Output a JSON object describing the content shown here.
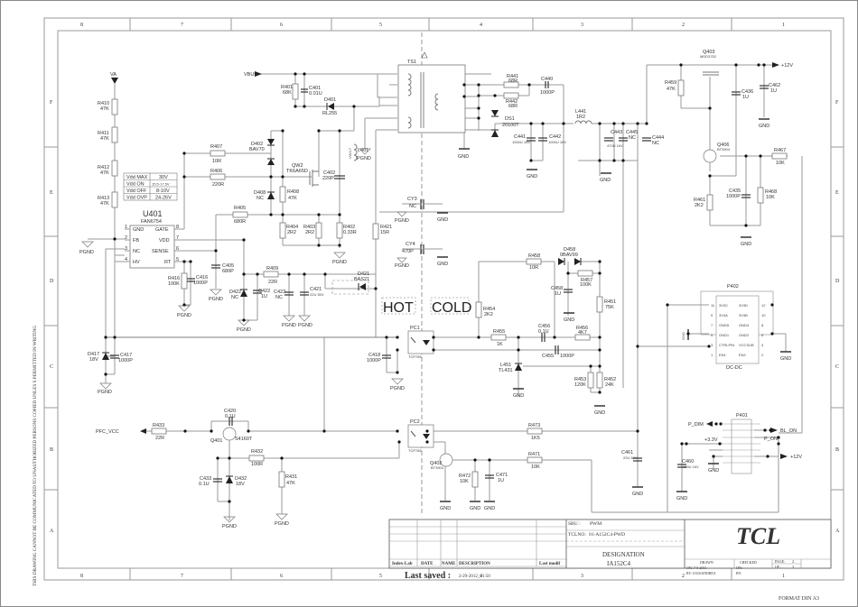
{
  "frame": {
    "columns_top": [
      "8",
      "7",
      "6",
      "5",
      "4",
      "3",
      "2",
      "1"
    ],
    "rows_right": [
      "F",
      "E",
      "D",
      "C",
      "B",
      "A"
    ],
    "rows_left": [
      "F",
      "E",
      "D",
      "C",
      "B",
      "A"
    ],
    "columns_bottom": [
      "8",
      "7",
      "6",
      "5",
      "4",
      "3",
      "2",
      "1"
    ],
    "side_notice": "THIS DRAWING CANNOT BE COMMUNICATED TO UNAUTHORIZED PERSONS COPIED UNLES S PERMITTED IN WRITING",
    "format": "FORMAT DIN A3"
  },
  "nets": {
    "va": "VA",
    "vbus": "VBUS",
    "pfc_vcc": "PFC_VCC",
    "p12v_top": "+12V",
    "p12v_bottom": "+12V",
    "p_dim": "P_DIM",
    "bl_on": "BL_ON",
    "p_on": "P_ON",
    "p3v3": "+3.3V",
    "hot": "HOT",
    "cold": "COLD"
  },
  "grounds": {
    "pgnd": "PGND",
    "gnd": "GND"
  },
  "u401": {
    "ref": "U401",
    "part": "FAN6754",
    "pins_left": [
      {
        "num": "1",
        "name": "GND"
      },
      {
        "num": "2",
        "name": "FB"
      },
      {
        "num": "3",
        "name": "NC"
      },
      {
        "num": "4",
        "name": "HV"
      }
    ],
    "pins_right": [
      {
        "num": "8",
        "name": "GATE"
      },
      {
        "num": "7",
        "name": "VDD"
      },
      {
        "num": "6",
        "name": "SENSE"
      },
      {
        "num": "5",
        "name": "RT"
      }
    ]
  },
  "vdd_table": [
    {
      "param": "Vdd MAX",
      "value": "30V"
    },
    {
      "param": "Vdd ON",
      "value": "15.5-17.5V"
    },
    {
      "param": "Vdd OFF",
      "value": "8-10V"
    },
    {
      "param": "Vdd OVP",
      "value": "24-26V"
    }
  ],
  "resistors": [
    {
      "ref": "R410",
      "value": "47K"
    },
    {
      "ref": "R411",
      "value": "47K"
    },
    {
      "ref": "R412",
      "value": "47K"
    },
    {
      "ref": "R413",
      "value": "47K"
    },
    {
      "ref": "R407",
      "value": "10R"
    },
    {
      "ref": "R406",
      "value": "220R"
    },
    {
      "ref": "R405",
      "value": "680R"
    },
    {
      "ref": "R408",
      "value": "47K"
    },
    {
      "ref": "R404",
      "value": "2R2"
    },
    {
      "ref": "R403",
      "value": "2R2"
    },
    {
      "ref": "R402",
      "value": "0.33R"
    },
    {
      "ref": "R401",
      "value": "68K"
    },
    {
      "ref": "R421",
      "value": "15R"
    },
    {
      "ref": "R416",
      "value": "100K"
    },
    {
      "ref": "R409",
      "value": "22R"
    },
    {
      "ref": "R441",
      "value": "68R"
    },
    {
      "ref": "R442",
      "value": "68R"
    },
    {
      "ref": "R459",
      "value": "47K"
    },
    {
      "ref": "R467",
      "value": "10K"
    },
    {
      "ref": "R468",
      "value": "10K"
    },
    {
      "ref": "R461",
      "value": "2K2"
    },
    {
      "ref": "R458",
      "value": "10R"
    },
    {
      "ref": "R457",
      "value": "100K"
    },
    {
      "ref": "R451",
      "value": "75K"
    },
    {
      "ref": "R454",
      "value": "2K2"
    },
    {
      "ref": "R455",
      "value": "1K"
    },
    {
      "ref": "R456",
      "value": "4K7"
    },
    {
      "ref": "R453",
      "value": "120K"
    },
    {
      "ref": "R452",
      "value": "24K"
    },
    {
      "ref": "R433",
      "value": "22R"
    },
    {
      "ref": "R432",
      "value": "100R"
    },
    {
      "ref": "R431",
      "value": "47K"
    },
    {
      "ref": "R473",
      "value": "1K5"
    },
    {
      "ref": "R471",
      "value": "10K"
    },
    {
      "ref": "R472",
      "value": "10K"
    }
  ],
  "capacitors": [
    {
      "ref": "C401",
      "value": "0.01U"
    },
    {
      "ref": "C402",
      "value": "220P"
    },
    {
      "ref": "C405",
      "value": "680P"
    },
    {
      "ref": "C416",
      "value": "1000P"
    },
    {
      "ref": "C422",
      "value": "1U"
    },
    {
      "ref": "C423",
      "value": "NC"
    },
    {
      "ref": "C421",
      "value": "22U 50V"
    },
    {
      "ref": "C417",
      "value": "1000P"
    },
    {
      "ref": "C418",
      "value": "1000P"
    },
    {
      "ref": "C420",
      "value": "0.1U"
    },
    {
      "ref": "C433",
      "value": "0.1U"
    },
    {
      "ref": "C440",
      "value": "1000P"
    },
    {
      "ref": "C441",
      "value": "1000U 16V"
    },
    {
      "ref": "C442",
      "value": "1000U 16V"
    },
    {
      "ref": "C443",
      "value": "470U 16V"
    },
    {
      "ref": "C445",
      "value": "NC"
    },
    {
      "ref": "C444",
      "value": "NC"
    },
    {
      "ref": "C436",
      "value": "1U"
    },
    {
      "ref": "C462",
      "value": "1U"
    },
    {
      "ref": "C435",
      "value": "1000P"
    },
    {
      "ref": "C458",
      "value": "1U"
    },
    {
      "ref": "C456",
      "value": "0.1U"
    },
    {
      "ref": "C455",
      "value": "1000P"
    },
    {
      "ref": "C461",
      "value": "22U 50V"
    },
    {
      "ref": "C471",
      "value": "1U"
    },
    {
      "ref": "C460",
      "value": "100U 16V"
    },
    {
      "ref": "CY3",
      "value": "NC"
    },
    {
      "ref": "CY4",
      "value": "470P"
    }
  ],
  "diodes": [
    {
      "ref": "D402",
      "value": "BAV70"
    },
    {
      "ref": "D408",
      "value": "NC"
    },
    {
      "ref": "D401",
      "value": "RL255"
    },
    {
      "ref": "D422",
      "value": "NC"
    },
    {
      "ref": "D421",
      "value": "BAS21"
    },
    {
      "ref": "D417",
      "value": "18V"
    },
    {
      "ref": "D432",
      "value": "18V"
    },
    {
      "ref": "DS1",
      "value": "20100T"
    },
    {
      "ref": "D458",
      "value": "0BAV99"
    }
  ],
  "transistors": [
    {
      "ref": "QW2",
      "value": "TK6A65D"
    },
    {
      "ref": "Q401",
      "value": "S4160T"
    },
    {
      "ref": "Q402",
      "value": "BT3904"
    },
    {
      "ref": "Q403",
      "value": "MDD3752"
    },
    {
      "ref": "Q406",
      "value": "BT3904"
    }
  ],
  "misc_parts": [
    {
      "ref": "TS1",
      "value": ""
    },
    {
      "ref": "L401",
      "value": "VW4.7"
    },
    {
      "ref": "L441",
      "value": "1R2"
    },
    {
      "ref": "L451",
      "value": "TL431"
    },
    {
      "ref": "PC1",
      "value": "TCP785"
    },
    {
      "ref": "PC2",
      "value": "TCP785"
    }
  ],
  "p402": {
    "ref": "P402",
    "label": "DC-DC",
    "pins": [
      {
        "num": "11",
        "name": "3V3C",
        "side": "left"
      },
      {
        "num": "12",
        "name": "3V3D",
        "side": "right"
      },
      {
        "num": "9",
        "name": "3V3A",
        "side": "left"
      },
      {
        "num": "10",
        "name": "3V3B",
        "side": "right"
      },
      {
        "num": "7",
        "name": "GND5",
        "side": "left"
      },
      {
        "num": "8",
        "name": "GND4",
        "side": "right"
      },
      {
        "num": "5",
        "name": "GND1",
        "side": "left"
      },
      {
        "num": "6",
        "name": "GND2",
        "side": "right"
      },
      {
        "num": "3",
        "name": "CTRLPIN",
        "side": "left"
      },
      {
        "num": "4",
        "name": "VCCSUB",
        "side": "right"
      },
      {
        "num": "1",
        "name": "EN1",
        "side": "left"
      },
      {
        "num": "2",
        "name": "EN2",
        "side": "right"
      }
    ]
  },
  "p401": {
    "ref": "P401"
  },
  "title_block": {
    "rev_headers": [
      "Index-Lab",
      "DATE",
      "NAME",
      "DESCRIPTION",
      "Last modif"
    ],
    "last_saved_label": "Last saved :",
    "last_saved_value": "2-29-2012_21:50",
    "sbu_label": "SBU :",
    "sbu_value": "PWM",
    "tclno_label": "TCLNO:",
    "tclno_value": "01-A152C4-PWD",
    "designation_label": "DESIGNATION",
    "designation_value": "IA152C4",
    "logo": "TCL",
    "drawn_label": "DRAWN",
    "drawn_on": "ON: 7-5-2011",
    "drawn_by": "BY: LIUSIANDREA",
    "checked_label": "CHECKED",
    "checked_on": "ON:",
    "checked_by": "BY:",
    "page_label": "PAGE:",
    "page_value": "2",
    "of_label": "OF :",
    "of_value": "3"
  }
}
